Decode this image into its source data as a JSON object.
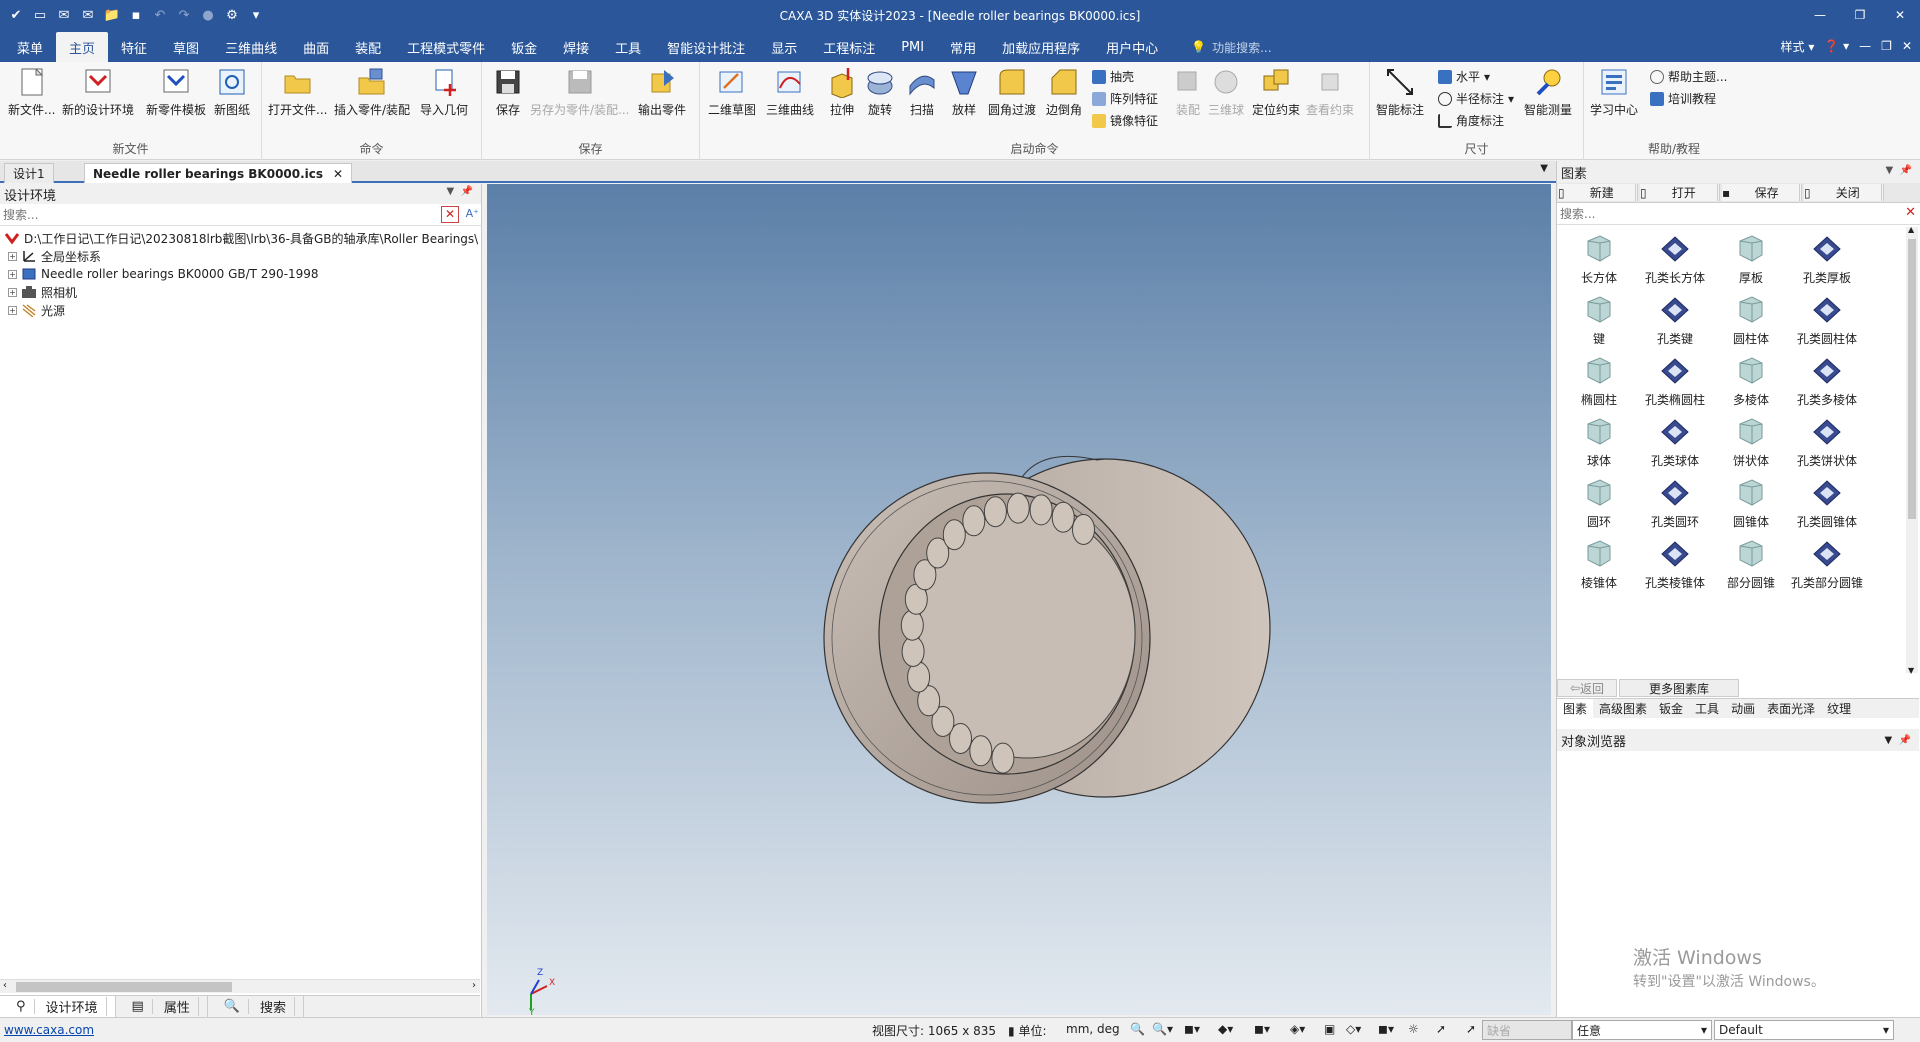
{
  "titlebar": {
    "title": "CAXA 3D 实体设计2023 - [Needle roller bearings BK0000.ics]",
    "quick_icons": [
      "logo-icon",
      "new-icon",
      "mail-icon",
      "mail-open-icon",
      "folder-icon",
      "save-icon",
      "undo-icon",
      "redo-icon",
      "record-icon",
      "settings-icon",
      "dropdown-icon"
    ],
    "window_buttons": [
      "minimize",
      "restore",
      "close"
    ]
  },
  "menubar": {
    "tabs": [
      "菜单",
      "主页",
      "特征",
      "草图",
      "三维曲线",
      "曲面",
      "装配",
      "工程模式零件",
      "钣金",
      "焊接",
      "工具",
      "智能设计批注",
      "显示",
      "工程标注",
      "PMI",
      "常用",
      "加载应用程序",
      "用户中心"
    ],
    "active": "主页",
    "search_placeholder": "功能搜索...",
    "style_label": "样式"
  },
  "ribbon": {
    "groups": [
      {
        "label": "新文件",
        "buttons": [
          "新文件...",
          "新的设计环境",
          "新零件模板",
          "新图纸"
        ]
      },
      {
        "label": "命令",
        "buttons": [
          "打开文件...",
          "插入零件/装配",
          "导入几何"
        ]
      },
      {
        "label": "保存",
        "buttons": [
          "保存",
          "另存为零件/装配...",
          "输出零件"
        ]
      },
      {
        "label": "启动命令",
        "buttons": [
          "二维草图",
          "三维曲线",
          "拉伸",
          "旋转",
          "扫描",
          "放样",
          "圆角过渡",
          "边倒角"
        ],
        "small": [
          "抽壳",
          "阵列特征",
          "镜像特征"
        ],
        "buttons2": [
          "装配",
          "三维球",
          "定位约束",
          "查看约束"
        ]
      },
      {
        "label": "尺寸",
        "buttons": [
          "智能标注"
        ],
        "small": [
          "水平",
          "半径标注",
          "角度标注"
        ],
        "buttons2": [
          "智能测量"
        ]
      },
      {
        "label": "帮助/教程",
        "buttons": [
          "学习中心"
        ],
        "small": [
          "帮助主题...",
          "培训教程"
        ]
      }
    ]
  },
  "doctabs": [
    "设计1",
    "Needle roller bearings BK0000.ics"
  ],
  "leftpanel": {
    "title": "设计环境",
    "search_placeholder": "搜索...",
    "tree": [
      {
        "label": "D:\\工作日记\\工作日记\\20230818lrb截图\\lrb\\36-具备GB的轴承库\\Roller Bearings\\",
        "icon": "design-env-icon",
        "level": 0
      },
      {
        "label": "全局坐标系",
        "icon": "axes-icon",
        "level": 1
      },
      {
        "label": "Needle roller bearings BK0000 GB/T 290-1998",
        "icon": "assembly-icon",
        "level": 1
      },
      {
        "label": "照相机",
        "icon": "camera-icon",
        "level": 1
      },
      {
        "label": "光源",
        "icon": "light-icon",
        "level": 1
      }
    ],
    "bottom_tabs": [
      "设计环境",
      "属性",
      "搜索"
    ]
  },
  "viewport": {
    "axes": {
      "x": "X",
      "y": "Y",
      "z": "Z"
    }
  },
  "rightpanel": {
    "title": "图素",
    "toolbar": [
      "新建",
      "打开",
      "保存",
      "关闭"
    ],
    "search_placeholder": "搜索...",
    "items": [
      "长方体",
      "孔类长方体",
      "厚板",
      "孔类厚板",
      "键",
      "孔类键",
      "圆柱体",
      "孔类圆柱体",
      "椭圆柱",
      "孔类椭圆柱",
      "多棱体",
      "孔类多棱体",
      "球体",
      "孔类球体",
      "饼状体",
      "孔类饼状体",
      "圆环",
      "孔类圆环",
      "圆锥体",
      "孔类圆锥体",
      "棱锥体",
      "孔类棱锥体",
      "部分圆锥",
      "孔类部分圆锥"
    ],
    "back_label": "返回",
    "more_label": "更多图素库",
    "tabs": [
      "图素",
      "高级图素",
      "钣金",
      "工具",
      "动画",
      "表面光泽",
      "纹理"
    ],
    "object_browser": "对象浏览器",
    "watermark_title": "激活 Windows",
    "watermark_sub": "转到\"设置\"以激活 Windows。"
  },
  "statusbar": {
    "link": "www.caxa.com",
    "view_size": "视图尺寸: 1065 x  835",
    "unit_label": "单位:",
    "unit_value": "mm, deg",
    "filter_disabled": "缺省",
    "select_mode": "任意",
    "style": "Default"
  },
  "colors": {
    "accent": "#2b579a",
    "part": "#b8aca2"
  }
}
